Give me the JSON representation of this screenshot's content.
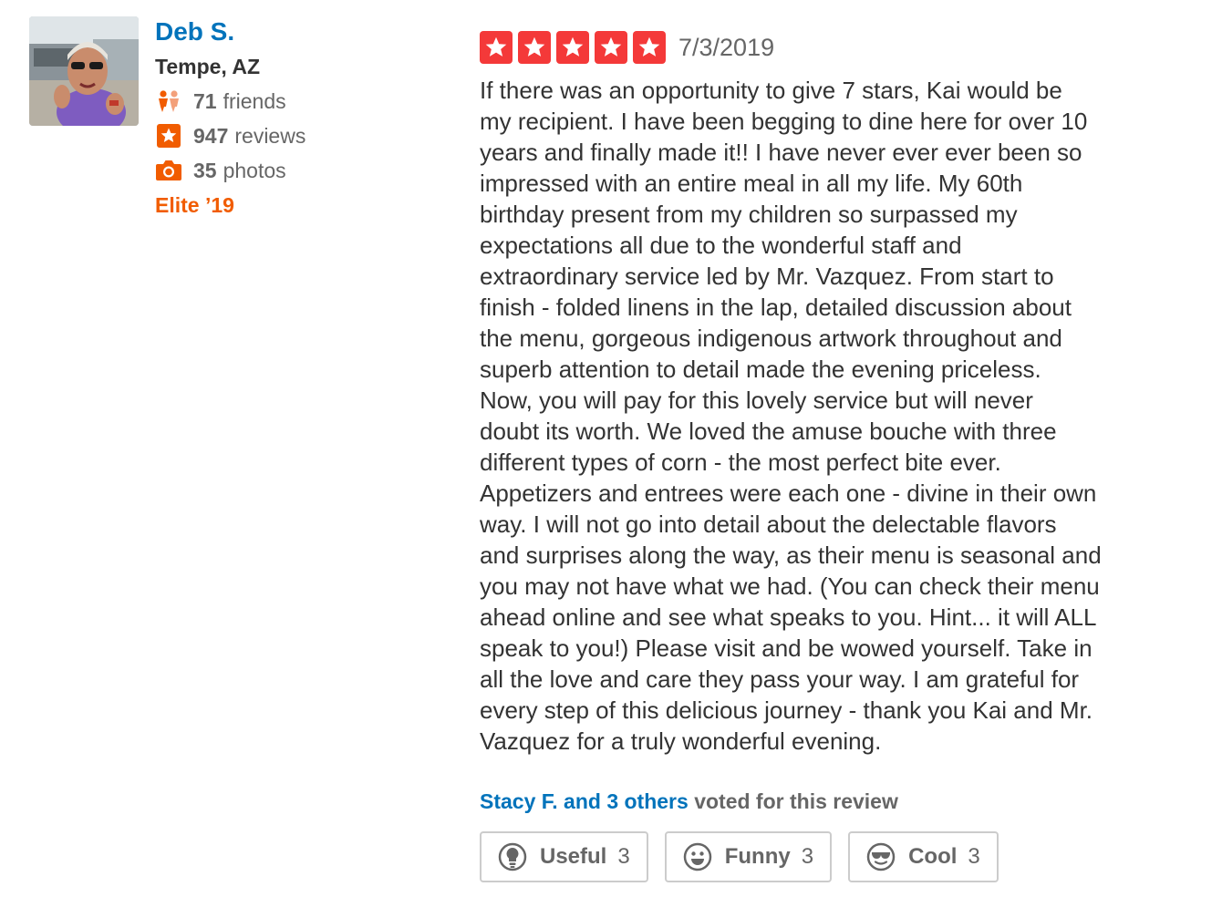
{
  "user": {
    "name": "Deb S.",
    "location": "Tempe, AZ",
    "friends_count": "71",
    "friends_label": "friends",
    "reviews_count": "947",
    "reviews_label": "reviews",
    "photos_count": "35",
    "photos_label": "photos",
    "elite": "Elite ’19",
    "icons": {
      "friends": "friends-icon",
      "reviews": "review-star-icon",
      "photos": "camera-icon"
    }
  },
  "review": {
    "rating": 5,
    "date": "7/3/2019",
    "text": "If there was an opportunity to give 7 stars, Kai would be\nmy recipient. I have been begging to dine here for over 10\nyears and finally made it!! I have never ever ever been so\nimpressed with an entire meal in all my life. My 60th\nbirthday present from my children so surpassed my\nexpectations all due to the wonderful staff and\nextraordinary service led by Mr. Vazquez. From start to\nfinish - folded linens in the lap, detailed discussion about\nthe menu, gorgeous indigenous artwork throughout and\nsuperb attention to detail made the evening priceless.\nNow, you will pay for this lovely service but will never\ndoubt its worth. We loved the amuse bouche with three\ndifferent types of corn - the most perfect bite ever.\nAppetizers and entrees were each one - divine in their own\nway. I will not go into detail about the delectable flavors\nand surprises along the way, as their menu is seasonal and\nyou may not have what we had. (You can check their menu\nahead online and see what speaks to you. Hint... it will ALL\nspeak to you!) Please visit and be wowed yourself. Take in\nall the love and care they pass your way. I am grateful for\nevery step of this delicious journey - thank you Kai and Mr.\nVazquez for a truly wonderful evening."
  },
  "votes": {
    "voters_link": "Stacy F. and 3 others",
    "voted_suffix": " voted for this review",
    "buttons": [
      {
        "label": "Useful",
        "count": "3",
        "icon": "lightbulb-icon"
      },
      {
        "label": "Funny",
        "count": "3",
        "icon": "smiley-icon"
      },
      {
        "label": "Cool",
        "count": "3",
        "icon": "sunglasses-icon"
      }
    ]
  },
  "colors": {
    "link_blue": "#0073bb",
    "star_red": "#f43939",
    "elite_orange": "#f15c00",
    "text_gray": "#666666",
    "body_text": "#333333"
  }
}
